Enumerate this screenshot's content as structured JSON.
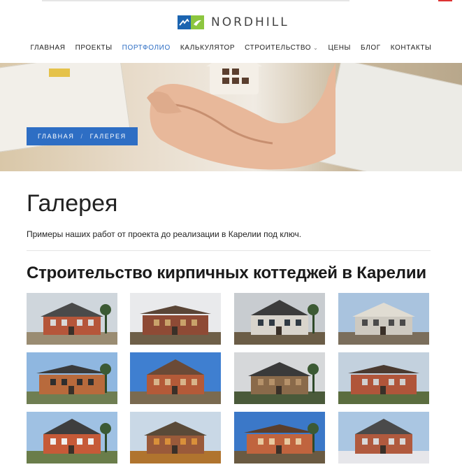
{
  "site": {
    "logo_text": "NORDHILL"
  },
  "nav": {
    "items": [
      {
        "label": "ГЛАВНАЯ",
        "name": "nav-home"
      },
      {
        "label": "ПРОЕКТЫ",
        "name": "nav-projects"
      },
      {
        "label": "ПОРТФОЛИО",
        "name": "nav-portfolio",
        "active": true
      },
      {
        "label": "КАЛЬКУЛЯТОР",
        "name": "nav-calculator"
      },
      {
        "label": "СТРОИТЕЛЬСТВО",
        "name": "nav-construction",
        "dropdown": true
      },
      {
        "label": "ЦЕНЫ",
        "name": "nav-prices"
      },
      {
        "label": "БЛОГ",
        "name": "nav-blog"
      },
      {
        "label": "КОНТАКТЫ",
        "name": "nav-contacts"
      }
    ],
    "accent_color": "#2e6ec4"
  },
  "breadcrumb": {
    "home": "ГЛАВНАЯ",
    "separator": "/",
    "current": "ГАЛЕРЕЯ"
  },
  "page": {
    "title": "Галерея",
    "lead": "Примеры наших работ от проекта до реализации в Карелии под ключ.",
    "section_title": "Строительство кирпичных коттеджей в Карелии"
  },
  "gallery": {
    "items": [
      {
        "sky": "#cfd6dc",
        "wall": "#b5563a",
        "roof": "#4a4a4a",
        "ground": "#9a8c72",
        "accent": "#d9d9d9"
      },
      {
        "sky": "#e9eaec",
        "wall": "#8e4a35",
        "roof": "#5a4536",
        "ground": "#6e5f48",
        "accent": "#c9a26a"
      },
      {
        "sky": "#c8ccd0",
        "wall": "#d8d4cc",
        "roof": "#3c3c3c",
        "ground": "#6b5d47",
        "accent": "#303a44"
      },
      {
        "sky": "#a9c3de",
        "wall": "#cdc9c0",
        "roof": "#e0dcd2",
        "ground": "#7b6e5c",
        "accent": "#4a4a4a"
      },
      {
        "sky": "#8fb7e0",
        "wall": "#b86a3c",
        "roof": "#3a3a3a",
        "ground": "#6f7e52",
        "accent": "#2e2e2e"
      },
      {
        "sky": "#3f7fd0",
        "wall": "#b45a38",
        "roof": "#6b4a36",
        "ground": "#7a6a50",
        "accent": "#d8b48a"
      },
      {
        "sky": "#d6d8da",
        "wall": "#8a6a4a",
        "roof": "#3a3a3a",
        "ground": "#4a5a3a",
        "accent": "#b6926a"
      },
      {
        "sky": "#c3d1de",
        "wall": "#b0553a",
        "roof": "#4a3a30",
        "ground": "#5b6d3f",
        "accent": "#d0d0d0"
      },
      {
        "sky": "#9fc1e3",
        "wall": "#c65a38",
        "roof": "#3e3e3e",
        "ground": "#6a7d4a",
        "accent": "#f0f0f0"
      },
      {
        "sky": "#c9d8e6",
        "wall": "#9a5a3a",
        "roof": "#5a4a38",
        "ground": "#b0742e",
        "accent": "#d9903a"
      },
      {
        "sky": "#3b78c8",
        "wall": "#c0643e",
        "roof": "#5a3e2c",
        "ground": "#6a5a42",
        "accent": "#e8c9a0"
      },
      {
        "sky": "#aac6e2",
        "wall": "#b05a3e",
        "roof": "#4a4a4a",
        "ground": "#e6e6ea",
        "accent": "#d9d9d9"
      }
    ]
  }
}
